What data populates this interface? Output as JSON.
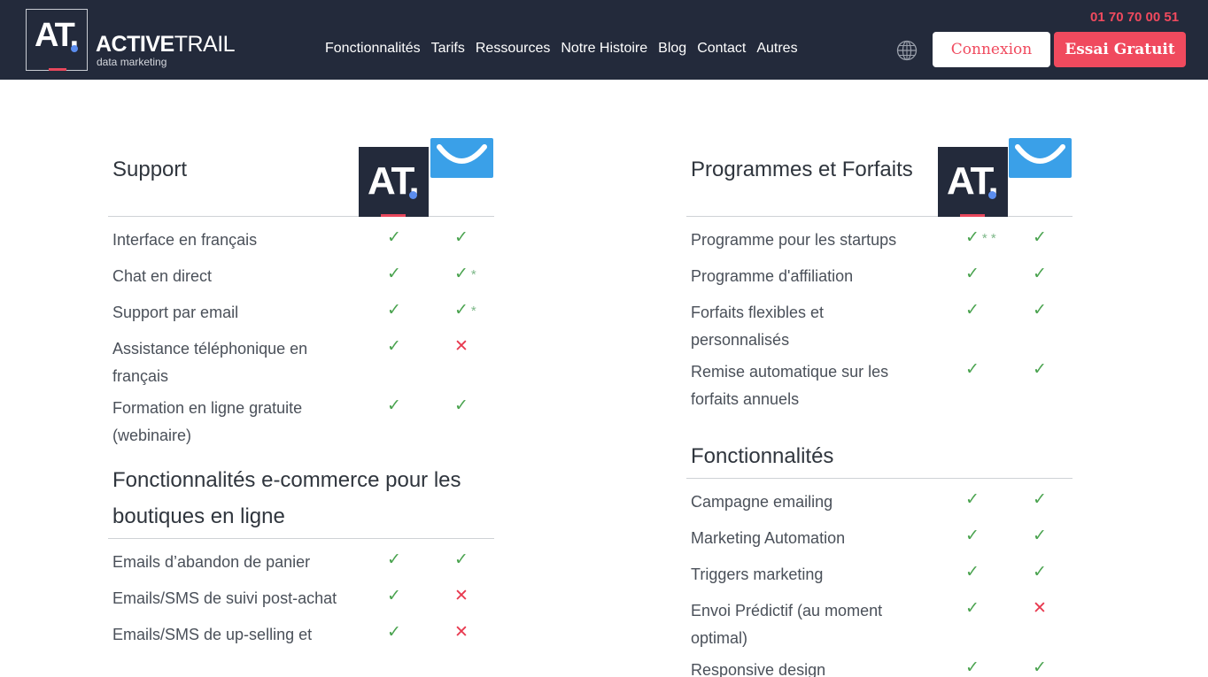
{
  "header": {
    "logo_text": "AT.",
    "brand_bold": "ACTIVE",
    "brand_thin": "TRAIL",
    "tagline": "data marketing",
    "phone": "01 70 70 00 51",
    "nav": [
      "Fonctionnalités",
      "Tarifs",
      "Ressources",
      "Notre Histoire",
      "Blog",
      "Contact",
      "Autres"
    ],
    "login_label": "Connexion",
    "trial_label": "Essai Gratuit",
    "globe_icon": "globe-icon"
  },
  "colors": {
    "header_bg": "#232a3b",
    "accent_red": "#f04a5e",
    "check_green": "#4aa34f",
    "cross_red": "#e8394f",
    "getresponse_blue": "#3aa0e8"
  },
  "left": {
    "sections": [
      {
        "title": "Support",
        "rows": [
          {
            "label": "Interface en français",
            "at": "yes",
            "at_note": "",
            "gr": "yes",
            "gr_note": ""
          },
          {
            "label": "Chat en direct",
            "at": "yes",
            "at_note": "",
            "gr": "yes",
            "gr_note": "*"
          },
          {
            "label": "Support par email",
            "at": "yes",
            "at_note": "",
            "gr": "yes",
            "gr_note": "*"
          },
          {
            "label": "Assistance téléphonique en français",
            "at": "yes",
            "at_note": "",
            "gr": "no",
            "gr_note": ""
          },
          {
            "label": "Formation en ligne gratuite (webinaire)",
            "at": "yes",
            "at_note": "",
            "gr": "yes",
            "gr_note": ""
          }
        ]
      },
      {
        "title": "Fonctionnalités e-commerce pour les boutiques en ligne",
        "rows": [
          {
            "label": "Emails d’abandon de panier",
            "at": "yes",
            "at_note": "",
            "gr": "yes",
            "gr_note": ""
          },
          {
            "label": "Emails/SMS de suivi post-achat",
            "at": "yes",
            "at_note": "",
            "gr": "no",
            "gr_note": ""
          },
          {
            "label": "Emails/SMS de up-selling et",
            "at": "yes",
            "at_note": "",
            "gr": "no",
            "gr_note": ""
          }
        ]
      }
    ]
  },
  "right": {
    "sections": [
      {
        "title": "Programmes et Forfaits",
        "rows": [
          {
            "label": "Programme pour les startups",
            "at": "yes",
            "at_note": "* *",
            "gr": "yes",
            "gr_note": ""
          },
          {
            "label": "Programme d'affiliation",
            "at": "yes",
            "at_note": "",
            "gr": "yes",
            "gr_note": ""
          },
          {
            "label": "Forfaits flexibles et personnalisés",
            "at": "yes",
            "at_note": "",
            "gr": "yes",
            "gr_note": ""
          },
          {
            "label": "Remise automatique sur les forfaits annuels",
            "at": "yes",
            "at_note": "",
            "gr": "yes",
            "gr_note": ""
          }
        ]
      },
      {
        "title": "Fonctionnalités",
        "rows": [
          {
            "label": "Campagne emailing",
            "at": "yes",
            "at_note": "",
            "gr": "yes",
            "gr_note": ""
          },
          {
            "label": "Marketing Automation",
            "at": "yes",
            "at_note": "",
            "gr": "yes",
            "gr_note": ""
          },
          {
            "label": "Triggers marketing",
            "at": "yes",
            "at_note": "",
            "gr": "yes",
            "gr_note": ""
          },
          {
            "label": "Envoi Prédictif (au moment optimal)",
            "at": "yes",
            "at_note": "",
            "gr": "no",
            "gr_note": ""
          },
          {
            "label": "Responsive design",
            "at": "yes",
            "at_note": "",
            "gr": "yes",
            "gr_note": ""
          }
        ]
      }
    ]
  }
}
